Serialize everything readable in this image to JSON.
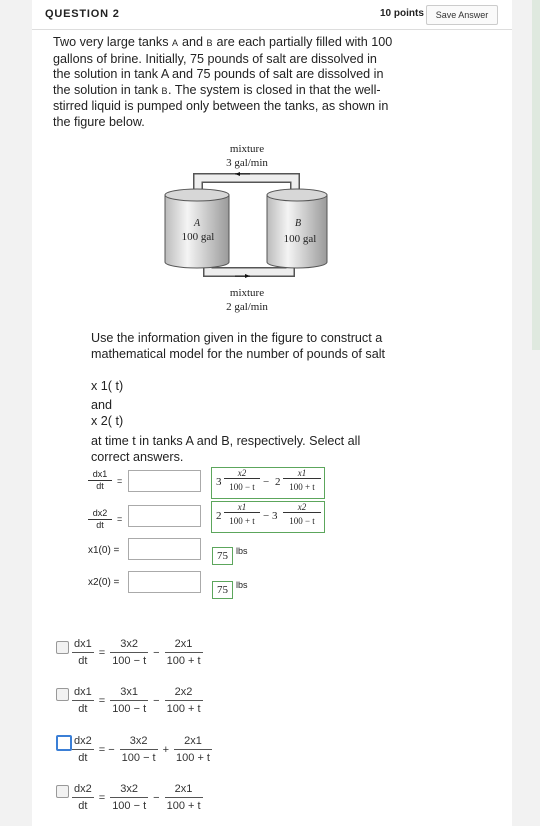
{
  "header": {
    "question": "QUESTION 2",
    "points": "10 points",
    "save": "Save Answer"
  },
  "question": {
    "line1a": "Two very large tanks ",
    "tankA": "A",
    "line1b": " and ",
    "tankB": "B",
    "line1c": " are each partially filled with",
    "rest": "100 gallons of brine. Initially, 75 pounds of salt are dissolved in the solution in tank A and 75 pounds of salt are dissolved in the solution in tank ",
    "tankB2": "B",
    "rest2": ". The system is closed in that the well-stirred liquid is pumped only between the tanks, as shown in the figure below."
  },
  "figure": {
    "top_label1": "mixture",
    "top_label2": "3 gal/min",
    "tankA_name": "A",
    "tankA_vol": "100 gal",
    "tankB_name": "B",
    "tankB_vol": "100 gal",
    "bottom_label1": "mixture",
    "bottom_label2": "2 gal/min"
  },
  "instructions": {
    "text": "Use the information given in the figure to construct a mathematical model for the number of pounds of salt",
    "x1": "x 1( t)",
    "and": "and",
    "x2": "x 2( t)",
    "tail": " at time  t in tanks  A and  B, respectively.  Select all correct answers."
  },
  "matching": {
    "dx1_num": "dx1",
    "dx1_den": "dt",
    "dx2_num": "dx2",
    "dx2_den": "dt",
    "equals": "=",
    "x1_0": "x1(0) =",
    "x2_0": "x2(0) =",
    "opt1": {
      "c1": "3",
      "n1": "x2",
      "d1": "100 − t",
      "op": "−",
      "c2": "2",
      "n2": "x1",
      "d2": "100 + t"
    },
    "opt2": {
      "c1": "2",
      "n1": "x1",
      "d1": "100 + t",
      "op": "− 3",
      "n2": "x2",
      "d2": "100 − t"
    },
    "val1": "75",
    "val2": "75",
    "units": "lbs"
  },
  "answers": [
    {
      "lhs_n": "dx1",
      "lhs_d": "dt",
      "eq": "=",
      "t1_n": "3x2",
      "t1_d": "100 − t",
      "op": "−",
      "t2_n": "2x1",
      "t2_d": "100 + t",
      "selected": false
    },
    {
      "lhs_n": "dx1",
      "lhs_d": "dt",
      "eq": "=",
      "t1_n": "3x1",
      "t1_d": "100 − t",
      "op": "−",
      "t2_n": "2x2",
      "t2_d": "100 + t",
      "selected": false
    },
    {
      "lhs_n": "dx2",
      "lhs_d": "dt",
      "eq": "= −",
      "t1_n": "3x2",
      "t1_d": "100 − t",
      "op": "+",
      "t2_n": "2x1",
      "t2_d": "100 + t",
      "selected": true
    },
    {
      "lhs_n": "dx2",
      "lhs_d": "dt",
      "eq": "=",
      "t1_n": "3x2",
      "t1_d": "100 − t",
      "op": "−",
      "t2_n": "2x1",
      "t2_d": "100 + t",
      "selected": false
    }
  ]
}
